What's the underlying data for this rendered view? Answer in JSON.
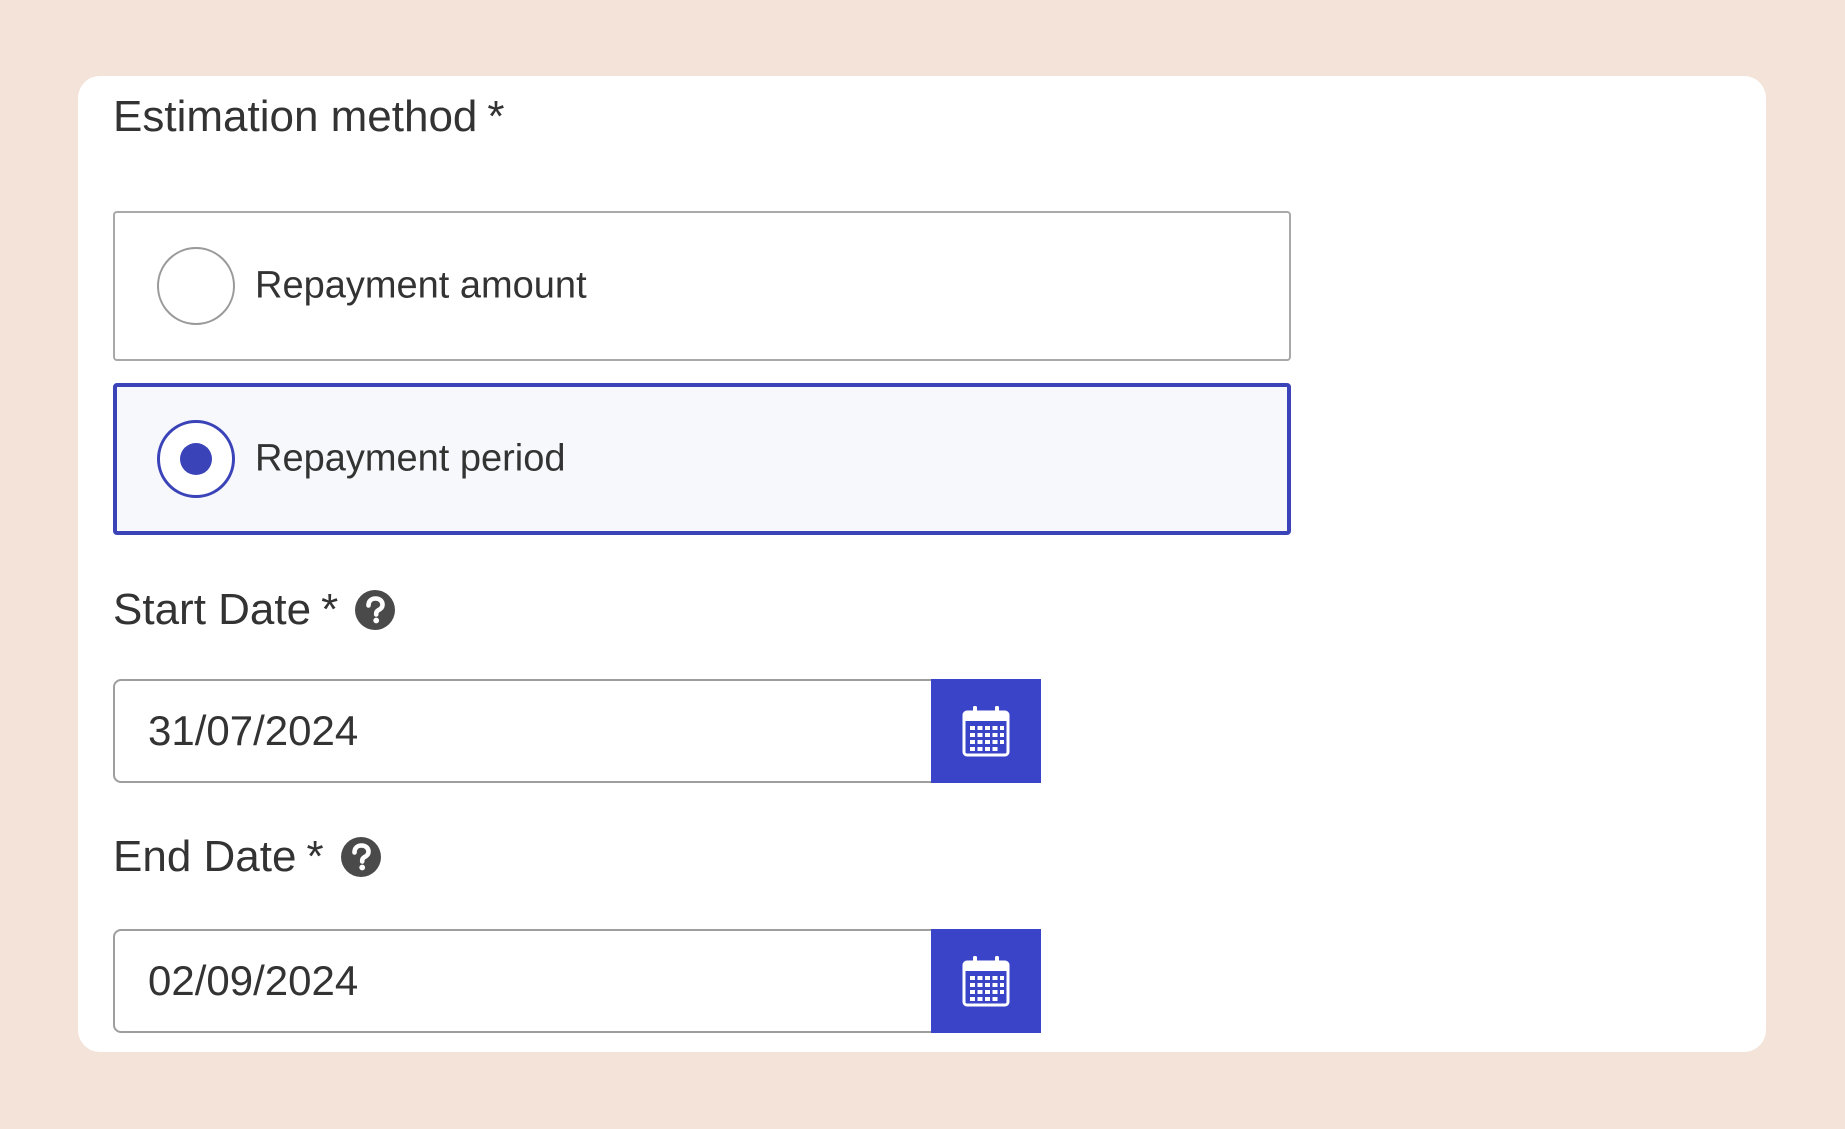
{
  "form": {
    "estimation_method": {
      "label": "Estimation method",
      "required_marker": "*",
      "options": [
        {
          "label": "Repayment amount",
          "selected": false
        },
        {
          "label": "Repayment period",
          "selected": true
        }
      ]
    },
    "start_date": {
      "label": "Start Date",
      "required_marker": "*",
      "value": "31/07/2024",
      "help_icon": "question-circle-icon",
      "calendar_icon": "calendar-icon"
    },
    "end_date": {
      "label": "End Date",
      "required_marker": "*",
      "value": "02/09/2024",
      "help_icon": "question-circle-icon",
      "calendar_icon": "calendar-icon"
    }
  },
  "colors": {
    "page_background": "#f3e3d8",
    "card_background": "#ffffff",
    "accent": "#3a44c8",
    "text": "#333333"
  }
}
